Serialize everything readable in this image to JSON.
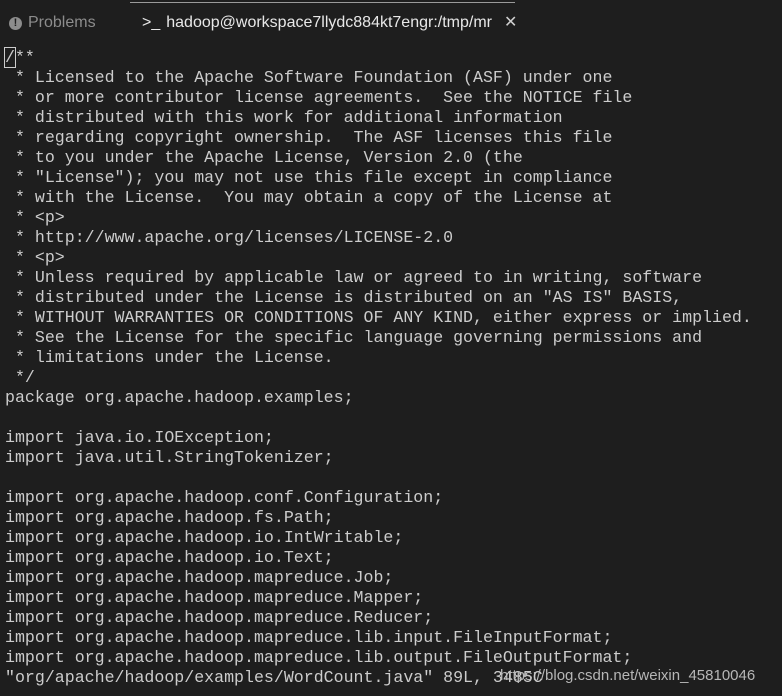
{
  "tabs": [
    {
      "label": "Problems",
      "icon": "warning-circle-icon",
      "active": false
    },
    {
      "label": "hadoop@workspace7llydc884kt7engr:/tmp/mr",
      "icon": "terminal-icon",
      "active": true
    }
  ],
  "terminal": {
    "first_char": "/",
    "first_rest": "**",
    "lines": [
      " * Licensed to the Apache Software Foundation (ASF) under one",
      " * or more contributor license agreements.  See the NOTICE file",
      " * distributed with this work for additional information",
      " * regarding copyright ownership.  The ASF licenses this file",
      " * to you under the Apache License, Version 2.0 (the",
      " * \"License\"); you may not use this file except in compliance",
      " * with the License.  You may obtain a copy of the License at",
      " * <p>",
      " * http://www.apache.org/licenses/LICENSE-2.0",
      " * <p>",
      " * Unless required by applicable law or agreed to in writing, software",
      " * distributed under the License is distributed on an \"AS IS\" BASIS,",
      " * WITHOUT WARRANTIES OR CONDITIONS OF ANY KIND, either express or implied.",
      " * See the License for the specific language governing permissions and",
      " * limitations under the License.",
      " */",
      "package org.apache.hadoop.examples;",
      "",
      "import java.io.IOException;",
      "import java.util.StringTokenizer;",
      "",
      "import org.apache.hadoop.conf.Configuration;",
      "import org.apache.hadoop.fs.Path;",
      "import org.apache.hadoop.io.IntWritable;",
      "import org.apache.hadoop.io.Text;",
      "import org.apache.hadoop.mapreduce.Job;",
      "import org.apache.hadoop.mapreduce.Mapper;",
      "import org.apache.hadoop.mapreduce.Reducer;",
      "import org.apache.hadoop.mapreduce.lib.input.FileInputFormat;",
      "import org.apache.hadoop.mapreduce.lib.output.FileOutputFormat;"
    ],
    "status_line": "\"org/apache/hadoop/examples/WordCount.java\" 89L, 3485C"
  },
  "watermark": "https://blog.csdn.net/weixin_45810046"
}
